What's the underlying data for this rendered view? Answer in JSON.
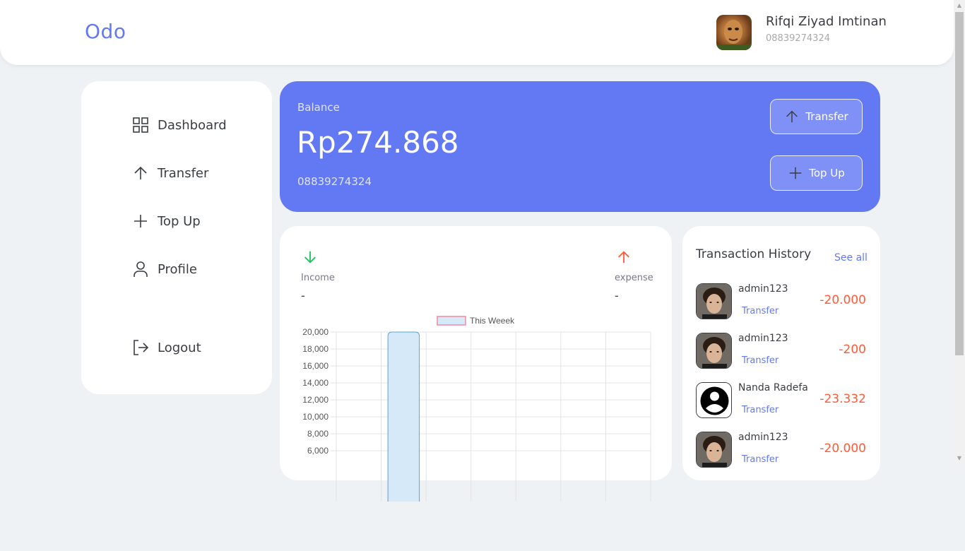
{
  "header": {
    "brand": "Odo",
    "user_name": "Rifqi Ziyad Imtinan",
    "user_phone": "08839274324"
  },
  "sidebar": {
    "items": [
      {
        "label": "Dashboard",
        "icon": "grid-icon"
      },
      {
        "label": "Transfer",
        "icon": "arrow-up-icon"
      },
      {
        "label": "Top Up",
        "icon": "plus-icon"
      },
      {
        "label": "Profile",
        "icon": "user-icon"
      }
    ],
    "logout": {
      "label": "Logout",
      "icon": "logout-icon"
    }
  },
  "balance": {
    "label": "Balance",
    "amount": "Rp274.868",
    "phone": "08839274324",
    "transfer_button": "Transfer",
    "topup_button": "Top Up"
  },
  "stats": {
    "income_label": "Income",
    "income_value": "-",
    "expense_label": "expense",
    "expense_value": "-"
  },
  "colors": {
    "accent": "#6379f4",
    "income": "#1ec15f",
    "expense": "#ff5b37",
    "bar_fill": "#d6e9f8",
    "bar_stroke": "#5aa4d8"
  },
  "chart_data": {
    "type": "bar",
    "legend": [
      "This Weeek"
    ],
    "legend_position": "top",
    "categories": [
      "",
      "",
      "",
      "",
      "",
      "",
      ""
    ],
    "series": [
      {
        "name": "This Weeek",
        "values": [
          0,
          20000,
          0,
          0,
          0,
          0,
          0
        ]
      }
    ],
    "y_ticks": [
      "20,000",
      "18,000",
      "16,000",
      "14,000",
      "12,000",
      "10,000",
      "8,000",
      "6,000"
    ],
    "ylim": [
      0,
      20000
    ],
    "grid": true
  },
  "history": {
    "title": "Transaction History",
    "see_all": "See all",
    "items": [
      {
        "name": "admin123",
        "type": "Transfer",
        "amount": "-20.000",
        "avatar": "photo"
      },
      {
        "name": "admin123",
        "type": "Transfer",
        "amount": "-200",
        "avatar": "photo"
      },
      {
        "name": "Nanda Radefa",
        "type": "Transfer",
        "amount": "-23.332",
        "avatar": "default"
      },
      {
        "name": "admin123",
        "type": "Transfer",
        "amount": "-20.000",
        "avatar": "photo"
      }
    ]
  }
}
